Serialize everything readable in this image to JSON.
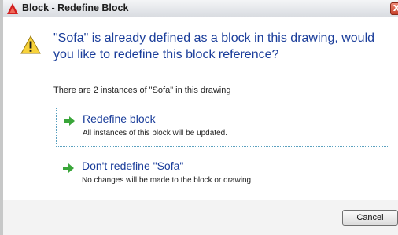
{
  "window": {
    "title": "Block - Redefine Block",
    "close_glyph": "X",
    "app_icon": "autocad-logo-icon",
    "close_icon": "close-icon"
  },
  "dialog": {
    "warning_icon": "warning-icon",
    "main_instruction": "\"Sofa\" is already defined as a block in this drawing, would you like to redefine this block reference?",
    "content": "There are 2 instances of \"Sofa\" in this drawing",
    "options": [
      {
        "title": "Redefine block",
        "description": "All instances of this block will be updated.",
        "icon": "green-arrow-icon"
      },
      {
        "title": "Don't redefine \"Sofa\"",
        "description": "No changes will be made to the block or drawing.",
        "icon": "green-arrow-icon"
      }
    ]
  },
  "footer": {
    "cancel_label": "Cancel"
  },
  "colors": {
    "instruction_blue": "#1a3d9a",
    "arrow_green": "#3aa63a",
    "warning_yellow": "#f7d23a",
    "close_red": "#c7402a"
  }
}
